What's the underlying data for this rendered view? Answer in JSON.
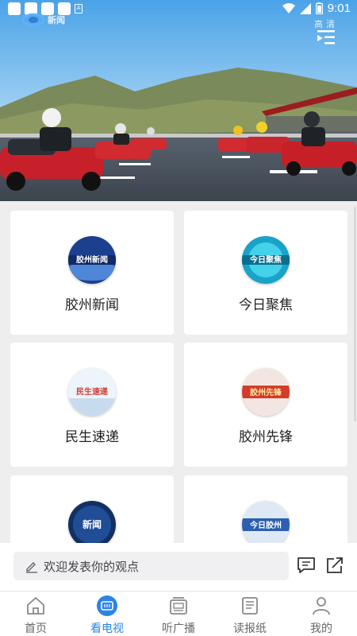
{
  "status_bar": {
    "time": "9:01"
  },
  "player": {
    "logo_text": "新闻",
    "quality_label": "高清"
  },
  "programs": [
    {
      "name": "胶州新闻",
      "thumb_text": "胶州新闻",
      "thumb_style": "blue"
    },
    {
      "name": "今日聚焦",
      "thumb_text": "今日聚焦",
      "thumb_style": "teal"
    },
    {
      "name": "民生速递",
      "thumb_text": "民生速递",
      "thumb_style": "light"
    },
    {
      "name": "胶州先锋",
      "thumb_text": "胶州先锋",
      "thumb_style": "red"
    },
    {
      "name": "",
      "thumb_text": "新闻",
      "thumb_style": "navy"
    },
    {
      "name": "",
      "thumb_text": "今日胶州",
      "thumb_style": "sky"
    }
  ],
  "comment": {
    "placeholder": "欢迎发表你的观点"
  },
  "nav": [
    {
      "label": "首页",
      "icon": "home-icon",
      "active": false
    },
    {
      "label": "看电视",
      "icon": "tv-icon",
      "active": true
    },
    {
      "label": "听广播",
      "icon": "radio-icon",
      "active": false
    },
    {
      "label": "读报纸",
      "icon": "newspaper-icon",
      "active": false
    },
    {
      "label": "我的",
      "icon": "profile-icon",
      "active": false
    }
  ],
  "colors": {
    "accent": "#2b84e6",
    "background": "#eeeeee"
  }
}
